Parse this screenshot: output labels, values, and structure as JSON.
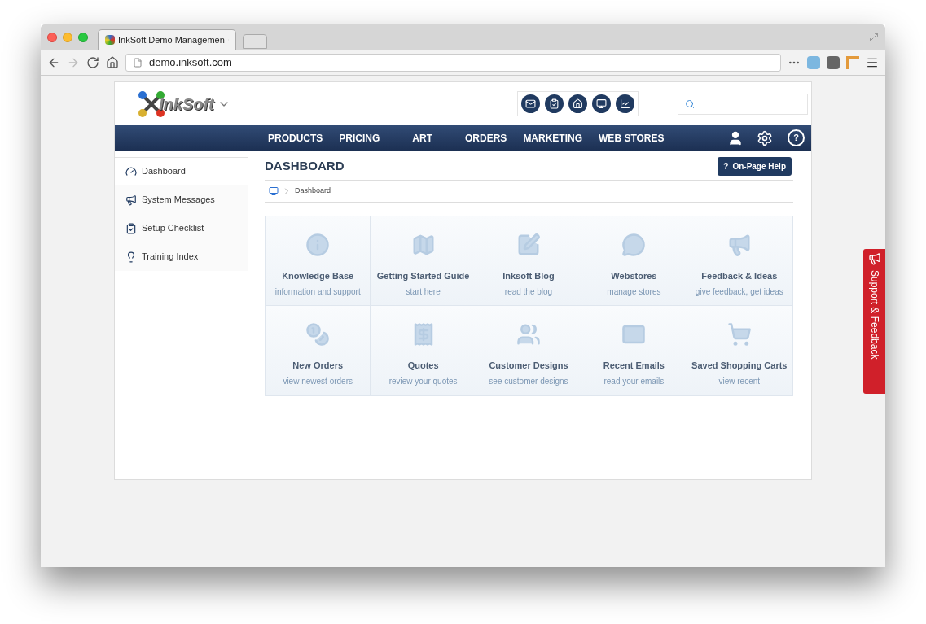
{
  "browser": {
    "tabs": [
      {
        "label": "InkSoft Demo Managemen",
        "selected": true
      }
    ],
    "address": "demo.inksoft.com"
  },
  "header": {
    "logo": "InkSoft"
  },
  "nav": {
    "items": [
      "PRODUCTS",
      "PRICING",
      "ART",
      "ORDERS",
      "MARKETING",
      "WEB STORES"
    ],
    "help": "?"
  },
  "sidebar": {
    "items": [
      {
        "label": "Dashboard",
        "selected": true
      },
      {
        "label": "System Messages",
        "selected": false
      },
      {
        "label": "Setup Checklist",
        "selected": false
      },
      {
        "label": "Training Index",
        "selected": false
      }
    ]
  },
  "main": {
    "title": "DASHBOARD",
    "help_button": "On-Page Help",
    "help_mark": "?",
    "breadcrumb": "Dashboard",
    "tiles": [
      {
        "title": "Knowledge Base",
        "subtitle": "information and support"
      },
      {
        "title": "Getting Started Guide",
        "subtitle": "start here"
      },
      {
        "title": "Inksoft Blog",
        "subtitle": "read the blog"
      },
      {
        "title": "Webstores",
        "subtitle": "manage stores"
      },
      {
        "title": "Feedback & Ideas",
        "subtitle": "give feedback, get ideas"
      },
      {
        "title": "New Orders",
        "subtitle": "view newest orders"
      },
      {
        "title": "Quotes",
        "subtitle": "review your quotes"
      },
      {
        "title": "Customer Designs",
        "subtitle": "see customer designs"
      },
      {
        "title": "Recent Emails",
        "subtitle": "read your emails"
      },
      {
        "title": "Saved Shopping Carts",
        "subtitle": "view recent"
      }
    ]
  },
  "side_tab": {
    "label": "Support & Feedback"
  }
}
